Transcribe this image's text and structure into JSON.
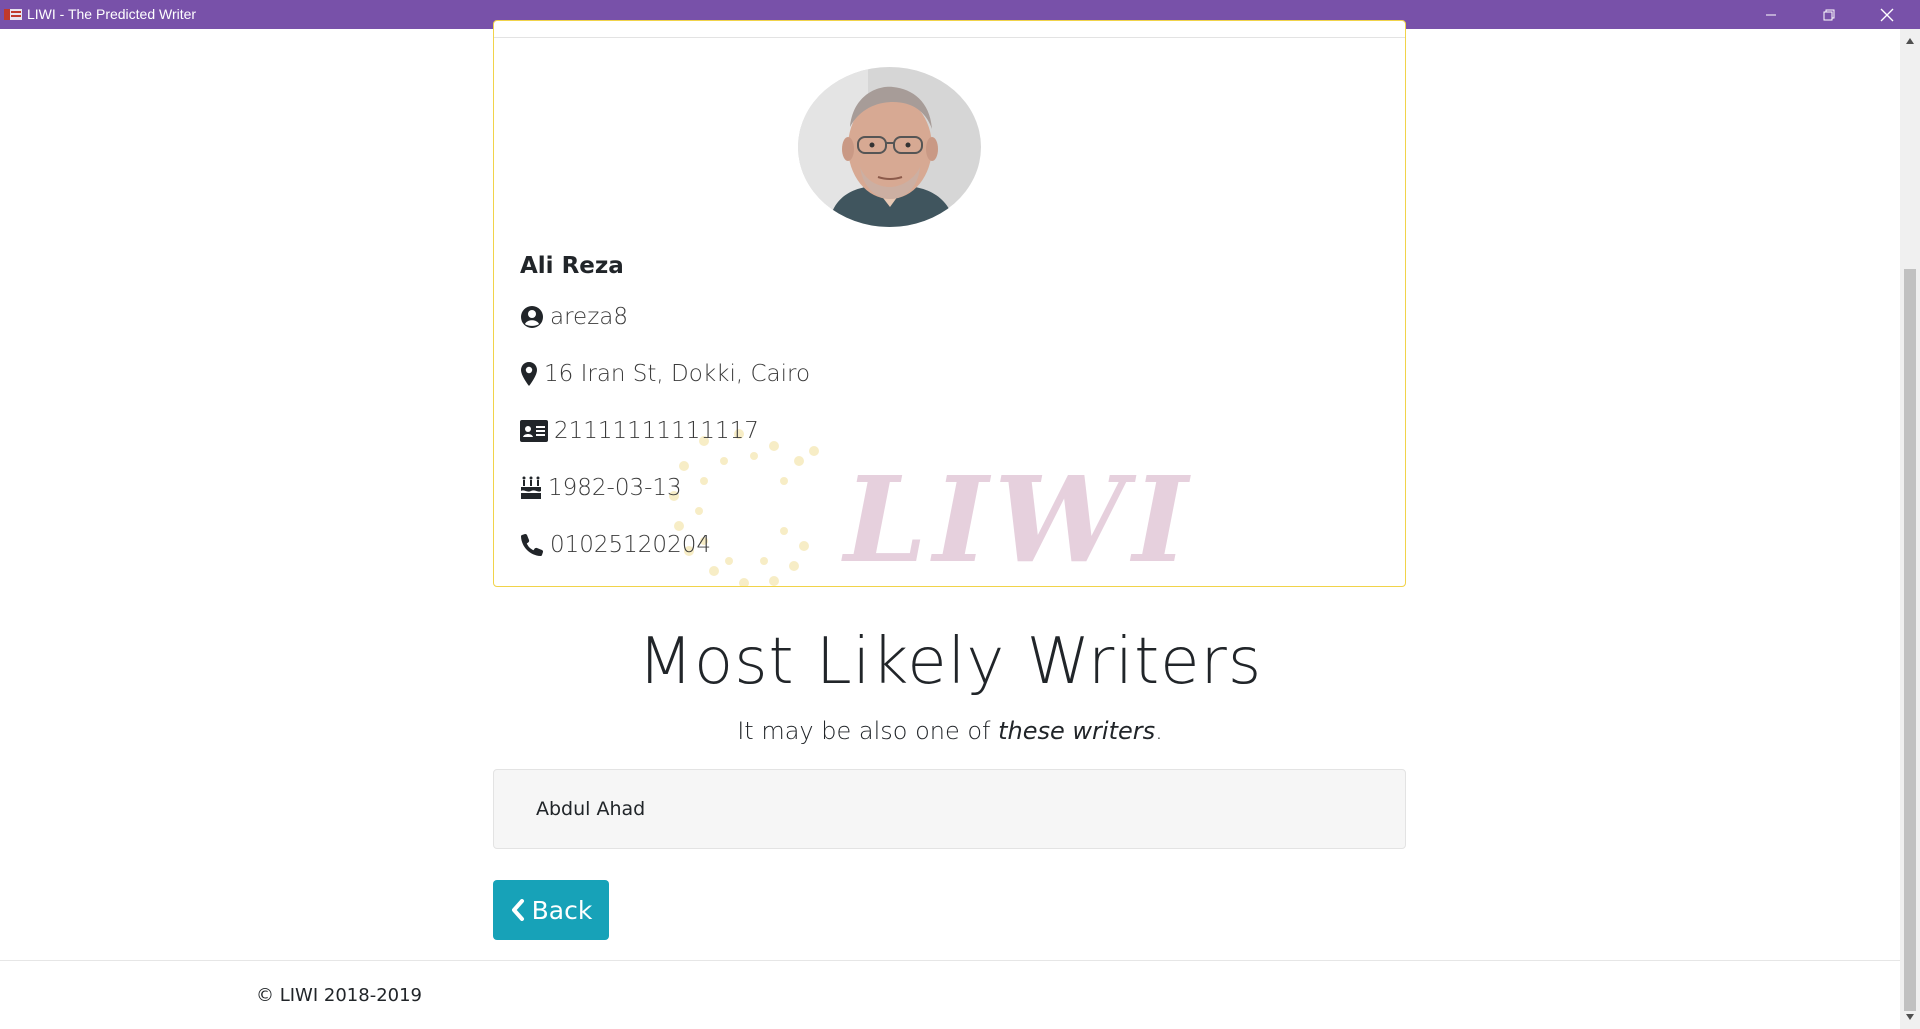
{
  "window": {
    "title": "LIWI - The Predicted Writer",
    "accent": "#7851a9"
  },
  "profile": {
    "name": "Ali Reza",
    "username": "areza8",
    "address": "16 Iran St, Dokki, Cairo",
    "national_id": "21111111111117",
    "birth_date": "1982-03-13",
    "phone": "01025120204",
    "card_border_color": "#f1d34a",
    "watermark_text": "LIWI"
  },
  "likely_writers": {
    "title": "Most Likely Writers",
    "subtitle_prefix": "It may be also one of ",
    "subtitle_emphasis": "these writers",
    "subtitle_suffix": ".",
    "items": [
      "Abdul Ahad"
    ]
  },
  "actions": {
    "back_label": "Back",
    "back_color": "#17a2b8"
  },
  "footer": {
    "text": "© LIWI 2018-2019"
  }
}
